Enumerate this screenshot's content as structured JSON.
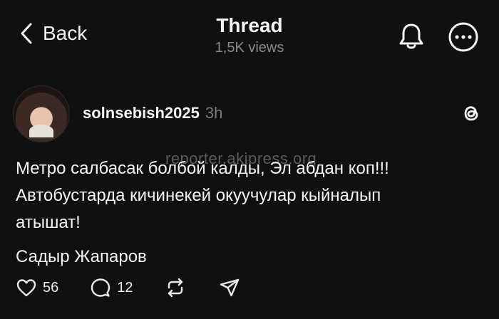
{
  "header": {
    "back_label": "Back",
    "title": "Thread",
    "views": "1,5K views",
    "icons": {
      "back": "chevron-left-icon",
      "bell": "bell-icon",
      "more": "more-icon"
    }
  },
  "post": {
    "username": "solnsebish2025",
    "time": "3h",
    "watermark": "reporter.akipress.org",
    "lines": [
      "Метро салбасак болбой калды,  Эл абдан коп!!!",
      "Автобустарда кичинекей окуучулар кыйналып",
      "атышат!"
    ],
    "signature": "Садыр Жапаров",
    "actions": {
      "likes": "56",
      "replies": "12"
    }
  },
  "colors": {
    "background": "#101010",
    "text": "#f3f5f7",
    "muted": "#7a7a7a"
  }
}
